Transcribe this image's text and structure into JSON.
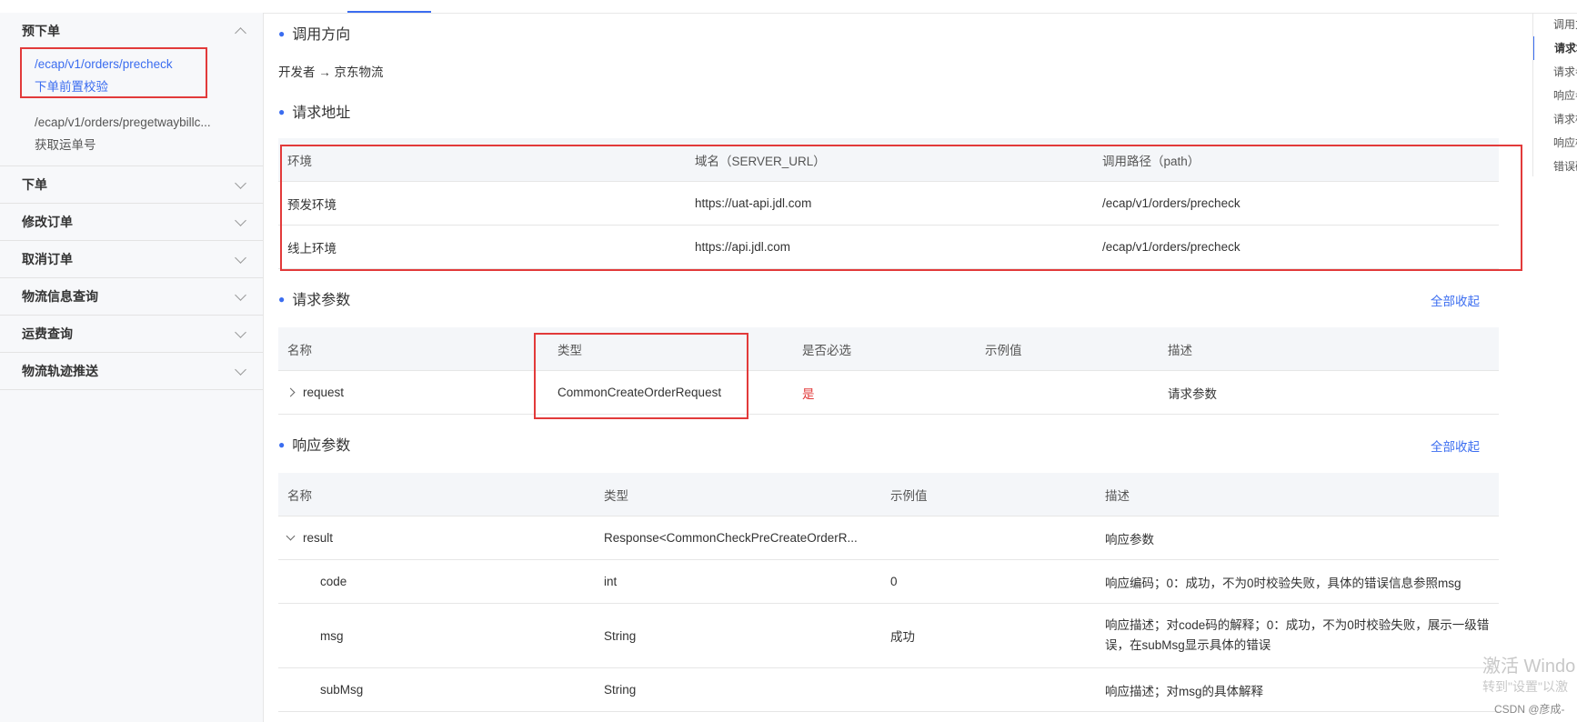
{
  "sidebar": {
    "groups": [
      {
        "label": "预下单",
        "expanded": true,
        "items": [
          {
            "path": "/ecap/v1/orders/precheck",
            "name": "下单前置校验",
            "active": true
          },
          {
            "path": "/ecap/v1/orders/pregetwaybillc...",
            "name": "获取运单号",
            "active": false
          }
        ]
      },
      {
        "label": "下单"
      },
      {
        "label": "修改订单"
      },
      {
        "label": "取消订单"
      },
      {
        "label": "物流信息查询"
      },
      {
        "label": "运费查询"
      },
      {
        "label": "物流轨迹推送"
      }
    ]
  },
  "call_direction": {
    "title": "调用方向",
    "from": "开发者",
    "arrow": "→",
    "to": "京东物流"
  },
  "request_address": {
    "title": "请求地址",
    "headers": [
      "环境",
      "域名（SERVER_URL）",
      "调用路径（path）"
    ],
    "rows": [
      [
        "预发环境",
        "https://uat-api.jdl.com",
        "/ecap/v1/orders/precheck"
      ],
      [
        "线上环境",
        "https://api.jdl.com",
        "/ecap/v1/orders/precheck"
      ]
    ]
  },
  "request_params": {
    "title": "请求参数",
    "collapse_all": "全部收起",
    "headers": [
      "名称",
      "类型",
      "是否必选",
      "示例值",
      "描述"
    ],
    "rows": [
      [
        "request",
        "CommonCreateOrderRequest",
        "是",
        "",
        "请求参数"
      ]
    ]
  },
  "response_params": {
    "title": "响应参数",
    "collapse_all": "全部收起",
    "headers": [
      "名称",
      "类型",
      "示例值",
      "描述"
    ],
    "rows": [
      [
        "result",
        "Response<CommonCheckPreCreateOrderR...",
        "",
        "响应参数"
      ],
      [
        "code",
        "int",
        "0",
        "响应编码；0：成功，不为0时校验失败，具体的错误信息参照msg"
      ],
      [
        "msg",
        "String",
        "成功",
        "响应描述；对code码的解释；0：成功，不为0时校验失败，展示一级错误，在subMsg显示具体的错误"
      ],
      [
        "subMsg",
        "String",
        "",
        "响应描述；对msg的具体解释"
      ]
    ]
  },
  "toc": [
    "调用方",
    "请求地",
    "请求参",
    "响应参",
    "请求样",
    "响应样",
    "错误码"
  ],
  "watermark": {
    "line1": "激活 Windo",
    "line2": "转到\"设置\"以激"
  },
  "csdn": "CSDN @彦成-",
  "colors": {
    "accent": "#3b6df0",
    "highlight_box": "#e23a3a",
    "required": "#e23a3a"
  }
}
